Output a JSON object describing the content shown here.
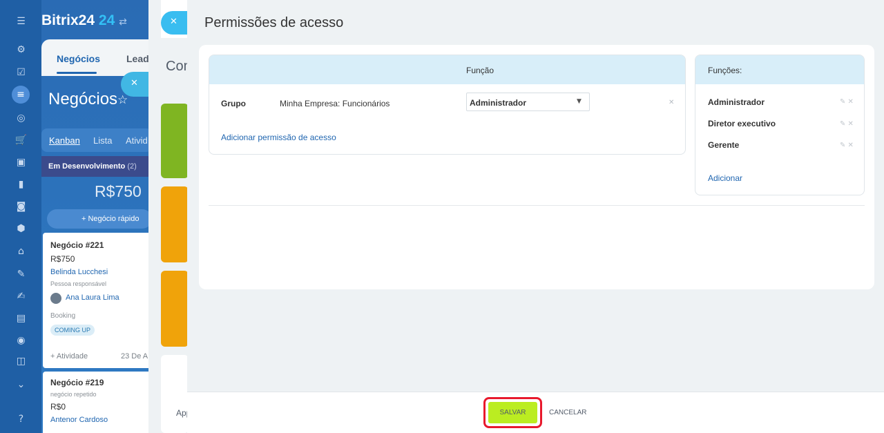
{
  "background": {
    "brand": "Bitrix24",
    "brand_number": "24",
    "tabs": [
      "Negócios",
      "Leads"
    ],
    "page_title": "Negócios",
    "views": [
      "Kanban",
      "Lista",
      "Ativid"
    ],
    "stage": {
      "name": "Em Desenvolvimento",
      "count": "(2)",
      "sum": "R$750"
    },
    "quick_deal": "+ Negócio rápido",
    "cards": [
      {
        "title": "Negócio #221",
        "price": "R$750",
        "contact": "Belinda Lucchesi",
        "responsible_label": "Pessoa responsável",
        "responsible": "Ana Laura Lima",
        "booking_label": "Booking",
        "badge": "COMING UP",
        "activity": "+ Atividade",
        "date": "23 De A"
      },
      {
        "title": "Negócio #219",
        "subtitle": "negócio repetido",
        "price": "R$0",
        "contact": "Antenor Cardoso"
      }
    ],
    "mid_panel_title": "Con",
    "mid_panel_footer": "App"
  },
  "slider": {
    "title": "Permissões de acesso",
    "permissions": {
      "column_header": "Função",
      "rows": [
        {
          "type": "Grupo",
          "name": "Minha Empresa: Funcionários",
          "role": "Administrador"
        }
      ],
      "add_link": "Adicionar permissão de acesso"
    },
    "roles": {
      "header": "Funções:",
      "items": [
        "Administrador",
        "Diretor executivo",
        "Gerente"
      ],
      "add_link": "Adicionar"
    },
    "footer": {
      "save_label": "SALVAR",
      "cancel_label": "CANCELAR"
    }
  },
  "colors": {
    "accent": "#2066b0",
    "save_button": "#bbed21",
    "highlight": "#e8192c",
    "table_header": "#d8eef9",
    "sidebar": "#1f5fa5"
  }
}
